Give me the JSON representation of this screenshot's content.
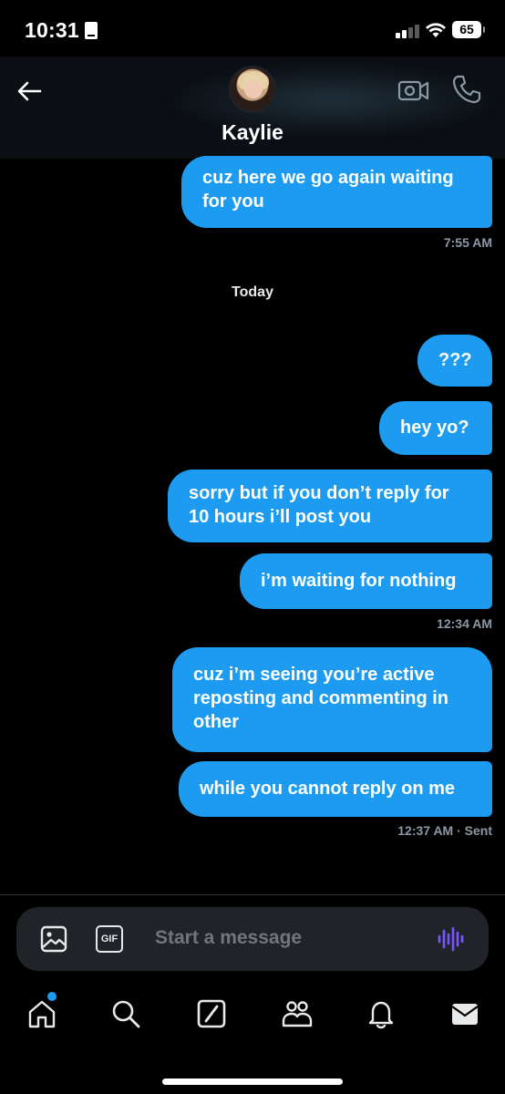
{
  "status_bar": {
    "time": "10:31",
    "battery": "65"
  },
  "header": {
    "contact_name": "Kaylie"
  },
  "messages": [
    {
      "text": "cuz here we go again waiting for you",
      "meta": "7:55 AM"
    },
    {
      "date_separator": "Today"
    },
    {
      "text": "???"
    },
    {
      "text": "hey yo?"
    },
    {
      "text": "sorry but if you don’t reply for 10 hours i’ll post you"
    },
    {
      "text": "i’m waiting for nothing",
      "meta": "12:34 AM"
    },
    {
      "text": "cuz i’m seeing you’re active reposting and commenting in other"
    },
    {
      "text": "while you cannot reply on me",
      "meta": "12:37 AM · Sent"
    }
  ],
  "composer": {
    "placeholder": "Start a message",
    "gif_label": "GIF"
  },
  "tabs": [
    "home-icon",
    "search-icon",
    "grok-icon",
    "communities-icon",
    "notifications-icon",
    "messages-icon"
  ],
  "colors": {
    "accent": "#1d9bf0",
    "bubble": "#1d9bf0",
    "background": "#000000",
    "voice": "#7856ff"
  }
}
